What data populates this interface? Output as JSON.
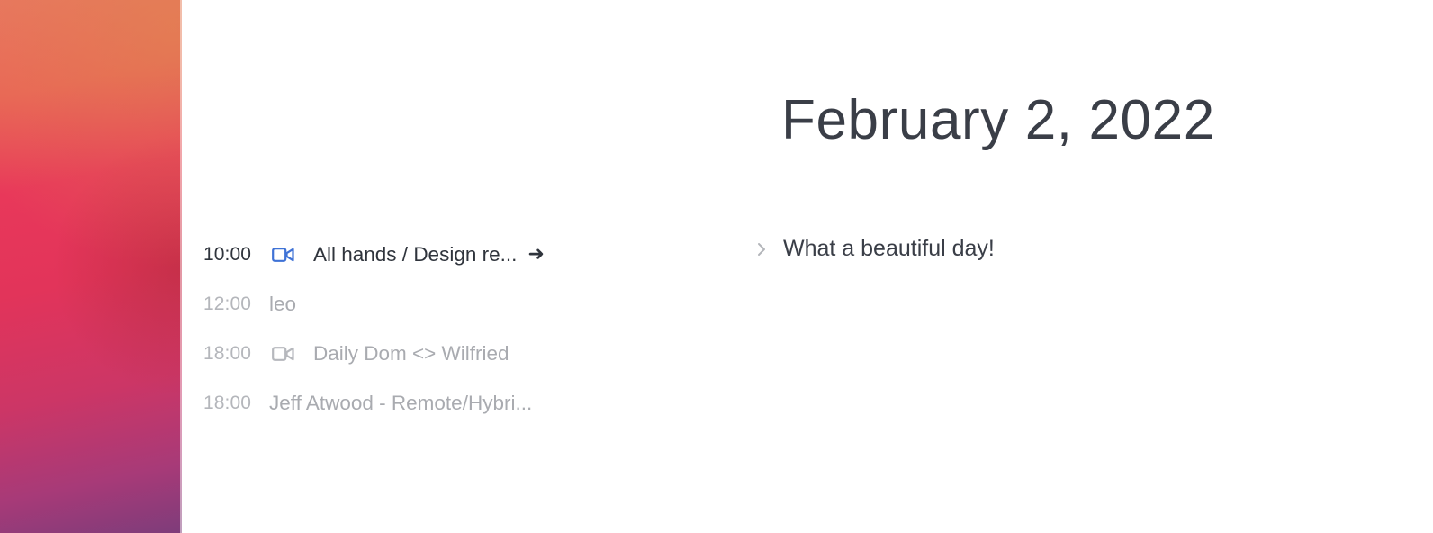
{
  "date_heading": "February 2, 2022",
  "note": {
    "text": "What a beautiful day!"
  },
  "events": [
    {
      "time": "10:00",
      "title": "All hands / Design re...",
      "icon": "video-camera-icon",
      "active": true,
      "arrow": "➜"
    },
    {
      "time": "12:00",
      "title": "leo",
      "icon": null,
      "active": false
    },
    {
      "time": "18:00",
      "title": "Daily Dom <> Wilfried",
      "icon": "video-camera-icon",
      "active": false
    },
    {
      "time": "18:00",
      "title": "Jeff Atwood - Remote/Hybri...",
      "icon": null,
      "active": false
    }
  ],
  "colors": {
    "active_video_icon": "#3f72d6",
    "inactive_video_icon": "#b6b8bd",
    "active_text": "#2f343c",
    "inactive_text": "#a9abb0"
  }
}
